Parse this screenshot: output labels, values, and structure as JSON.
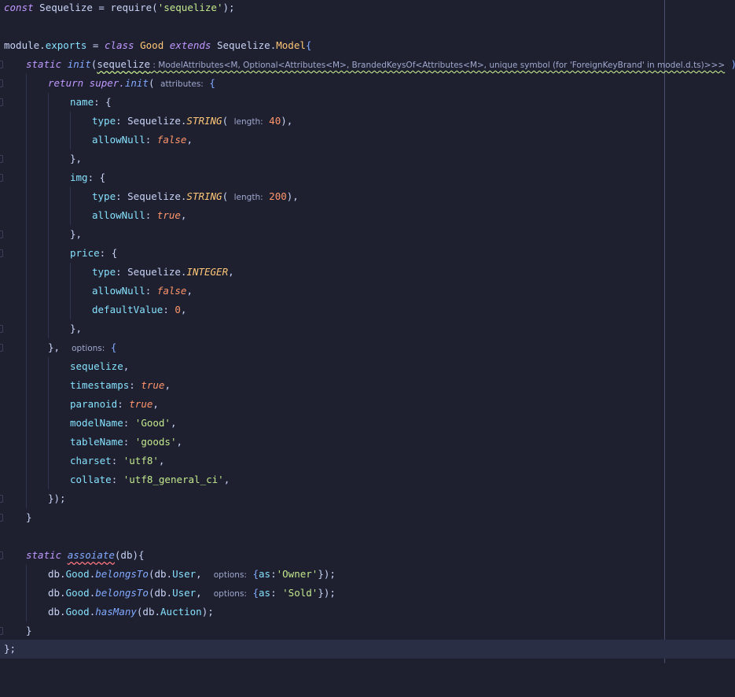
{
  "editor": {
    "l1": {
      "a": "const",
      "b": " Sequelize = require(",
      "c": "'sequelize'",
      "d": ");"
    },
    "l3": {
      "a": "module.",
      "b": "exports",
      "c": " = ",
      "d": "class",
      "e": " ",
      "f": "Good",
      "g": " ",
      "h": "extends",
      "i": " Sequelize.",
      "j": "Model",
      "k": "{"
    },
    "l4": {
      "a": "static",
      "b": "init",
      "c": "(",
      "d": "sequelize",
      "e": " : ModelAttributes<M, Optional<Attributes<M>, BrandedKeysOf<Attributes<M>, unique symbol (for 'ForeignKeyBrand' in model.d.ts)>>>",
      "f": " ){"
    },
    "l5": {
      "a": "return",
      "b": " super.",
      "c": "init",
      "d": "( ",
      "e": "attributes:",
      "f": " {"
    },
    "l6": {
      "a": "name",
      "b": ": {"
    },
    "l7": {
      "a": "type",
      "b": ": Sequelize.",
      "c": "STRING",
      "d": "( ",
      "e": "length:",
      "f": " 40",
      "g": "),"
    },
    "l8": {
      "a": "allowNull",
      "b": ": ",
      "c": "false",
      "d": ","
    },
    "l9": {
      "a": "},"
    },
    "l10": {
      "a": "img",
      "b": ": {"
    },
    "l11": {
      "a": "type",
      "b": ": Sequelize.",
      "c": "STRING",
      "d": "( ",
      "e": "length:",
      "f": " 200",
      "g": "),"
    },
    "l12": {
      "a": "allowNull",
      "b": ": ",
      "c": "true",
      "d": ","
    },
    "l13": {
      "a": "},"
    },
    "l14": {
      "a": "price",
      "b": ": {"
    },
    "l15": {
      "a": "type",
      "b": ": Sequelize.",
      "c": "INTEGER",
      "d": ","
    },
    "l16": {
      "a": "allowNull",
      "b": ": ",
      "c": "false",
      "d": ","
    },
    "l17": {
      "a": "defaultValue",
      "b": ": ",
      "c": "0",
      "d": ","
    },
    "l18": {
      "a": "},"
    },
    "l19": {
      "a": "},  ",
      "b": "options:",
      "c": " {"
    },
    "l20": {
      "a": "sequelize",
      "b": ","
    },
    "l21": {
      "a": "timestamps",
      "b": ": ",
      "c": "true",
      "d": ","
    },
    "l22": {
      "a": "paranoid",
      "b": ": ",
      "c": "true",
      "d": ","
    },
    "l23": {
      "a": "modelName",
      "b": ": ",
      "c": "'Good'",
      "d": ","
    },
    "l24": {
      "a": "tableName",
      "b": ": ",
      "c": "'goods'",
      "d": ","
    },
    "l25": {
      "a": "charset",
      "b": ": ",
      "c": "'utf8'",
      "d": ","
    },
    "l26": {
      "a": "collate",
      "b": ": ",
      "c": "'utf8_general_ci'",
      "d": ","
    },
    "l27": {
      "a": "});"
    },
    "l28": {
      "a": "}"
    },
    "l30": {
      "a": "static",
      "b": " ",
      "c": "assoiate",
      "d": "(db){"
    },
    "l31": {
      "a": "db.",
      "b": "Good",
      "c": ".",
      "d": "belongsTo",
      "e": "(db.",
      "f": "User",
      "g": ",  ",
      "h": "options:",
      "i": " {",
      "j": "as",
      "k": ":",
      "l": "'Owner'",
      "m": "});"
    },
    "l32": {
      "a": "db.",
      "b": "Good",
      "c": ".",
      "d": "belongsTo",
      "e": "(db.",
      "f": "User",
      "g": ",  ",
      "h": "options:",
      "i": " {",
      "j": "as",
      "k": ": ",
      "l": "'Sold'",
      "m": "});"
    },
    "l33": {
      "a": "db.",
      "b": "Good",
      "c": ".",
      "d": "hasMany",
      "e": "(db.",
      "f": "Auction",
      "g": ");"
    },
    "l34": {
      "a": "}"
    },
    "l35": {
      "a": "};"
    }
  },
  "colors": {
    "background": "#1e2030",
    "current_line": "#2a2e44",
    "keyword": "#c099ff",
    "class_name": "#ffc777",
    "property": "#86e1fc",
    "string": "#c3e88d",
    "number": "#ff966c",
    "function": "#82aaff"
  }
}
